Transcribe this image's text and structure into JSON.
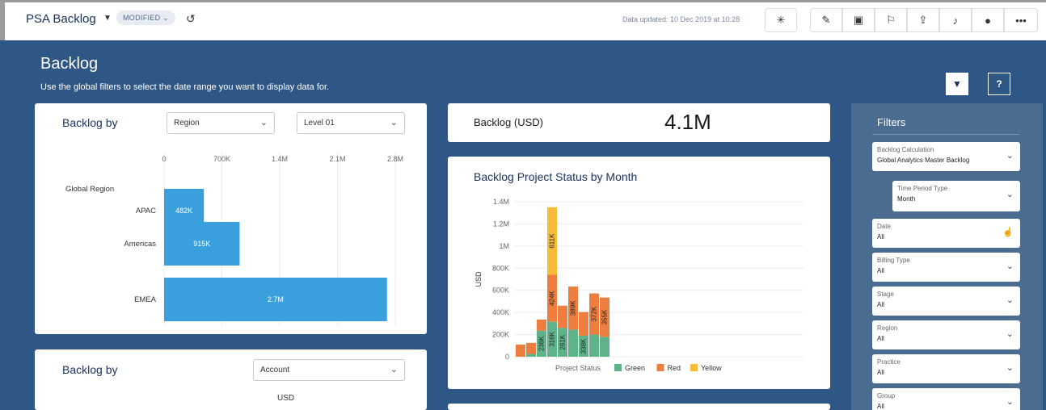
{
  "topbar": {
    "title": "PSA Backlog",
    "modified": "MODIFIED",
    "data_updated": "Data updated: 10 Dec 2019 at 10:28",
    "buttons": [
      {
        "name": "sparkle-icon",
        "glyph": "✳"
      },
      {
        "name": "pencil-icon",
        "glyph": "✎"
      },
      {
        "name": "save-icon",
        "glyph": "▣"
      },
      {
        "name": "bookmark-icon",
        "glyph": "⚐"
      },
      {
        "name": "share-icon",
        "glyph": "⇪"
      },
      {
        "name": "bell-icon",
        "glyph": "♪"
      },
      {
        "name": "chat-icon",
        "glyph": "●"
      },
      {
        "name": "more-icon",
        "glyph": "•••"
      }
    ]
  },
  "page": {
    "title": "Backlog",
    "subtitle": "Use the global filters to select the date range you want to display data for.",
    "help_label": "?"
  },
  "card1": {
    "title": "Backlog by",
    "dropdown1": "Region",
    "dropdown2": "Level 01",
    "row_header": "Global Region"
  },
  "card2": {
    "label": "Backlog (USD)",
    "value": "4.1M"
  },
  "card3": {
    "title": "Backlog Project Status by Month"
  },
  "card4": {
    "title": "Backlog by",
    "dropdown": "Account",
    "unit": "USD"
  },
  "chart_data": [
    {
      "type": "bar",
      "orientation": "horizontal",
      "categories": [
        "APAC",
        "Americas",
        "EMEA"
      ],
      "values": [
        482000,
        915000,
        2700000
      ],
      "data_labels": [
        "482K",
        "915K",
        "2.7M"
      ],
      "x_ticks": [
        "0",
        "700K",
        "1.4M",
        "2.1M",
        "2.8M"
      ],
      "xlim": [
        0,
        2800000
      ],
      "color": "#3aa0dd"
    },
    {
      "type": "bar",
      "stacked": true,
      "ylabel": "USD",
      "ylim": [
        0,
        1400000
      ],
      "y_ticks": [
        "0",
        "200K",
        "400K",
        "600K",
        "800K",
        "1M",
        "1.2M",
        "1.4M"
      ],
      "legend_title": "Project Status",
      "legend_position": "bottom",
      "series": [
        {
          "name": "Green",
          "color": "#5fb38a",
          "values": [
            0,
            25000,
            236000,
            316000,
            261000,
            245000,
            190000,
            200000,
            180000
          ]
        },
        {
          "name": "Red",
          "color": "#ee7e3f",
          "values": [
            110000,
            100000,
            100000,
            424000,
            200000,
            389000,
            214000,
            372000,
            355000
          ]
        },
        {
          "name": "Yellow",
          "color": "#f5bb39",
          "values": [
            0,
            0,
            0,
            611000,
            0,
            0,
            0,
            0,
            0
          ]
        }
      ],
      "segment_labels": [
        {
          "bar": 2,
          "series": 0,
          "text": "236K"
        },
        {
          "bar": 3,
          "series": 0,
          "text": "316K"
        },
        {
          "bar": 3,
          "series": 1,
          "text": "424K"
        },
        {
          "bar": 3,
          "series": 2,
          "text": "611K"
        },
        {
          "bar": 4,
          "series": 0,
          "text": "261K"
        },
        {
          "bar": 5,
          "series": 1,
          "text": "389K"
        },
        {
          "bar": 6,
          "series": 0,
          "text": "338K"
        },
        {
          "bar": 7,
          "series": 1,
          "text": "372K"
        },
        {
          "bar": 8,
          "series": 1,
          "text": "355K"
        }
      ]
    }
  ],
  "filters": {
    "title": "Filters",
    "items": [
      {
        "label": "Backlog Calculation",
        "value": "Global Analytics Master Backlog",
        "control": "chevron"
      },
      {
        "label": "Time Period Type",
        "value": "Month",
        "control": "chevron"
      },
      {
        "label": "Date",
        "value": "All",
        "control": "hand"
      },
      {
        "label": "Billing Type",
        "value": "All",
        "control": "chevron"
      },
      {
        "label": "Stage",
        "value": "All",
        "control": "chevron"
      },
      {
        "label": "Region",
        "value": "All",
        "control": "chevron"
      },
      {
        "label": "Practice",
        "value": "All",
        "control": "chevron"
      },
      {
        "label": "Group",
        "value": "All",
        "control": "chevron"
      }
    ]
  }
}
